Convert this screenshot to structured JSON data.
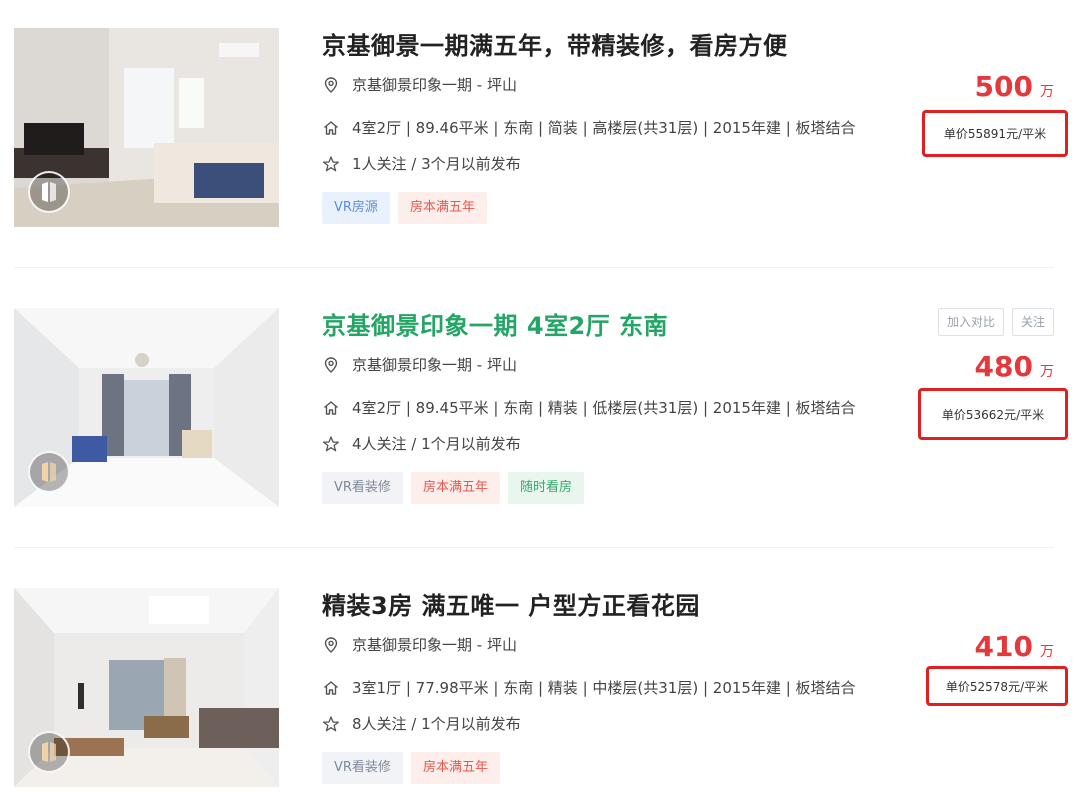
{
  "listings": [
    {
      "title": "京基御景一期满五年，带精装修，看房方便",
      "location": "京基御景印象一期 - 坪山",
      "info": "4室2厅 | 89.46平米 | 东南 | 简装 | 高楼层(共31层) | 2015年建 | 板塔结合",
      "follow": "1人关注 / 3个月以前发布",
      "tags": [
        "VR房源",
        "房本满五年"
      ],
      "price": "500",
      "price_unit": "万",
      "unit_price": "单价55891元/平米"
    },
    {
      "title": "京基御景印象一期 4室2厅 东南",
      "location": "京基御景印象一期 - 坪山",
      "info": "4室2厅 | 89.45平米 | 东南 | 精装 | 低楼层(共31层) | 2015年建 | 板塔结合",
      "follow": "4人关注 / 1个月以前发布",
      "tags": [
        "VR看装修",
        "房本满五年",
        "随时看房"
      ],
      "price": "480",
      "price_unit": "万",
      "unit_price": "单价53662元/平米",
      "compare_label": "加入对比",
      "follow_label": "关注"
    },
    {
      "title": "精装3房 满五唯一 户型方正看花园",
      "location": "京基御景印象一期 - 坪山",
      "info": "3室1厅 | 77.98平米 | 东南 | 精装 | 中楼层(共31层) | 2015年建 | 板塔结合",
      "follow": "8人关注 / 1个月以前发布",
      "tags": [
        "VR看装修",
        "房本满五年"
      ],
      "price": "410",
      "price_unit": "万",
      "unit_price": "单价52578元/平米"
    }
  ],
  "icons": {
    "location": "location-pin-icon",
    "house": "house-icon",
    "star": "star-icon",
    "vr": "vr-badge-icon"
  },
  "colors": {
    "price": "#e4393c",
    "highlight_title": "#23a566",
    "annotation_box": "#e02020"
  }
}
